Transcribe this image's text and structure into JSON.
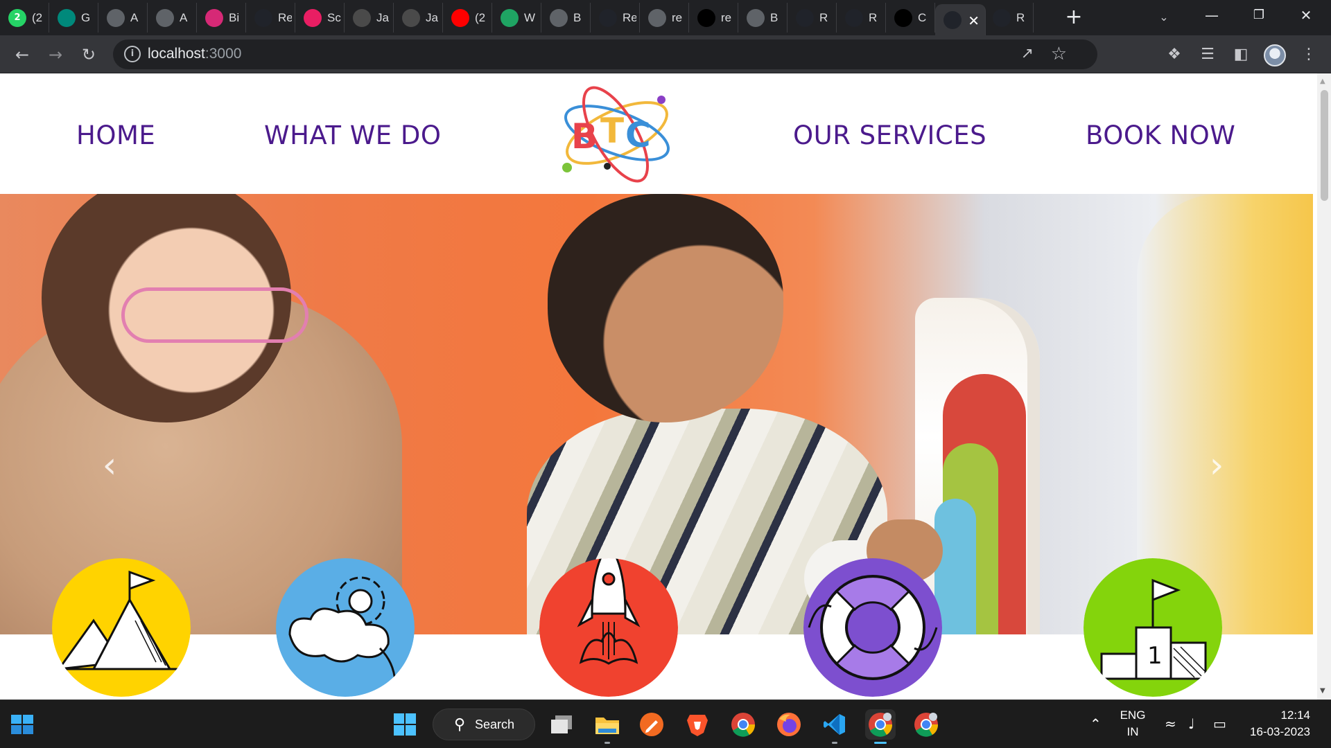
{
  "browser": {
    "tabs": [
      {
        "icon": "whatsapp-icon",
        "badge": "2",
        "title": "(2",
        "color": "#25d366"
      },
      {
        "icon": "meet-icon",
        "badge": "",
        "title": "G",
        "color": "#00897b"
      },
      {
        "icon": "site-logo-icon",
        "badge": "",
        "title": "A",
        "color": "#5f6368"
      },
      {
        "icon": "globe-icon",
        "badge": "",
        "title": "A",
        "color": "#5f6368"
      },
      {
        "icon": "instagram-icon",
        "badge": "",
        "title": "Bi",
        "color": "#d62976"
      },
      {
        "icon": "react-icon",
        "badge": "",
        "title": "Re",
        "color": "#20232a"
      },
      {
        "icon": "swirl-icon",
        "badge": "",
        "title": "Sc",
        "color": "#e91e63"
      },
      {
        "icon": "mountain-icon",
        "badge": "",
        "title": "Ja",
        "color": "#4a4a4a"
      },
      {
        "icon": "mountain-icon",
        "badge": "",
        "title": "Ja",
        "color": "#4a4a4a"
      },
      {
        "icon": "youtube-icon",
        "badge": "",
        "title": "(2",
        "color": "#ff0000"
      },
      {
        "icon": "drive-icon",
        "badge": "",
        "title": "W",
        "color": "#1fa463"
      },
      {
        "icon": "globe-icon",
        "badge": "",
        "title": "B",
        "color": "#5f6368"
      },
      {
        "icon": "react-icon",
        "badge": "",
        "title": "Re",
        "color": "#20232a"
      },
      {
        "icon": "globe-icon",
        "badge": "",
        "title": "re",
        "color": "#5f6368"
      },
      {
        "icon": "github-icon",
        "badge": "",
        "title": "re",
        "color": "#000000"
      },
      {
        "icon": "globe-icon",
        "badge": "",
        "title": "B",
        "color": "#5f6368"
      },
      {
        "icon": "react-icon",
        "badge": "",
        "title": "R",
        "color": "#20232a"
      },
      {
        "icon": "react-icon",
        "badge": "",
        "title": "R",
        "color": "#20232a"
      },
      {
        "icon": "codepen-icon",
        "badge": "",
        "title": "C",
        "color": "#000000"
      },
      {
        "icon": "react-icon",
        "badge": "",
        "title": "",
        "color": "#20232a",
        "active": true
      },
      {
        "icon": "bootstrap-icon",
        "badge": "",
        "title": "R",
        "color": "#20232a"
      }
    ],
    "new_tab_label": "+",
    "address": {
      "host": "localhost",
      "port": ":3000"
    }
  },
  "site": {
    "nav": {
      "home": "HOME",
      "what_we_do": "WHAT WE DO",
      "our_services": "OUR SERVICES",
      "book_now": "BOOK NOW"
    },
    "logo_text": "BTC",
    "carousel": {
      "prev_glyph": "‹",
      "next_glyph": "›",
      "slide_count": 2,
      "active_slide": 0
    },
    "feature_icons": [
      {
        "name": "mountain-flag-icon",
        "color": "#ffd300"
      },
      {
        "name": "cloud-gear-icon",
        "color": "#5aaee6"
      },
      {
        "name": "rocket-icon",
        "color": "#f0422f"
      },
      {
        "name": "lifebuoy-icon",
        "color": "#7d4fcf"
      },
      {
        "name": "podium-icon",
        "color": "#84d40c"
      }
    ]
  },
  "taskbar": {
    "search_label": "Search",
    "language_top": "ENG",
    "language_bottom": "IN",
    "time": "12:14",
    "date": "16-03-2023"
  },
  "colors": {
    "nav_text": "#4b1a8c",
    "chrome_dark": "#202124",
    "toolbar": "#35363a"
  }
}
